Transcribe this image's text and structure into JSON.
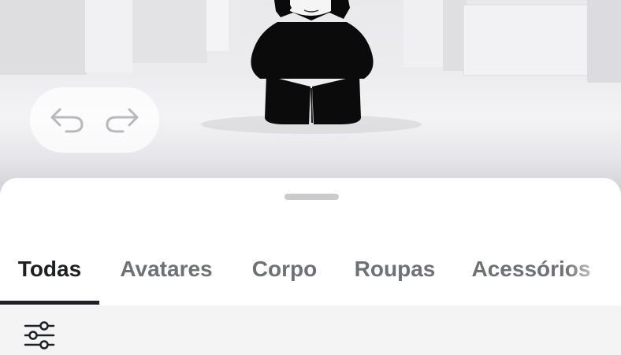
{
  "viewport": {
    "undo_icon": "undo-arrow-icon",
    "redo_icon": "redo-arrow-icon"
  },
  "tabs": [
    {
      "label": "Todas",
      "active": true
    },
    {
      "label": "Avatares",
      "active": false
    },
    {
      "label": "Corpo",
      "active": false
    },
    {
      "label": "Roupas",
      "active": false
    },
    {
      "label": "Acessórios",
      "active": false
    }
  ],
  "filter": {
    "icon": "filter-sliders-icon"
  },
  "colors": {
    "active_tab": "#1f2024",
    "inactive_tab": "#6f7176",
    "sheet_background": "#ffffff",
    "filter_bar_background": "#f4f4f5"
  }
}
